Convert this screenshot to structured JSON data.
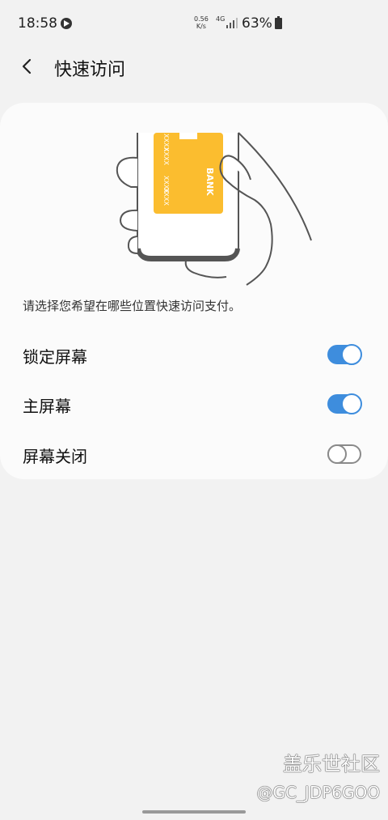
{
  "status_bar": {
    "time": "18:58",
    "net_speed_value": "0.56",
    "net_speed_unit": "K/s",
    "net_type": "4G",
    "battery": "63%"
  },
  "header": {
    "title": "快速访问"
  },
  "illustration": {
    "card_text": "BANK",
    "card_numbers": [
      "XXXX",
      "XXXX",
      "XXXX",
      "XXXX"
    ],
    "card_color": "#fbbd2f"
  },
  "description": "请选择您希望在哪些位置快速访问支付。",
  "options": [
    {
      "label": "锁定屏幕",
      "enabled": true
    },
    {
      "label": "主屏幕",
      "enabled": true
    },
    {
      "label": "屏幕关闭",
      "enabled": false
    }
  ],
  "watermark": {
    "title": "盖乐世社区",
    "user": "@GC_JDP6GOO"
  },
  "colors": {
    "accent": "#3e8ddd",
    "background": "#f2f2f2",
    "card": "#fbfbfb"
  }
}
